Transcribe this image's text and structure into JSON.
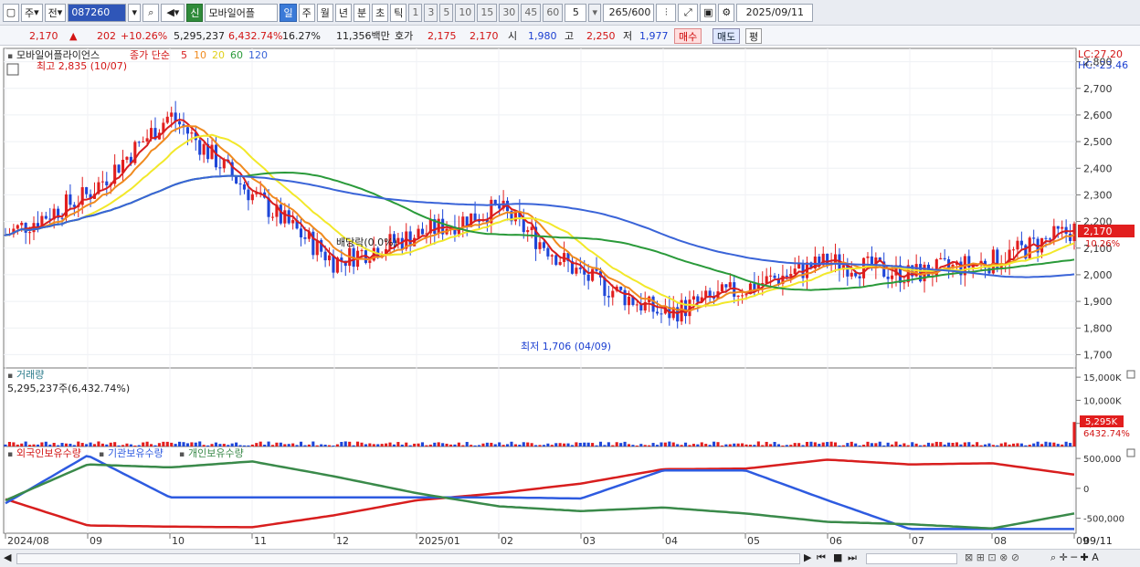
{
  "toolbar": {
    "type_label": "주",
    "prev_label": "전",
    "stock_code": "087260",
    "new_badge": "신",
    "stock_name": "모바일어플",
    "periods": [
      "일",
      "주",
      "월",
      "년",
      "분",
      "초",
      "틱"
    ],
    "active_period": "일",
    "minute_options": [
      "1",
      "3",
      "5",
      "10",
      "15",
      "30",
      "45",
      "60"
    ],
    "interval_value": "5",
    "count_value": "265",
    "count_total": "/600",
    "date_value": "2025/09/11"
  },
  "quote": {
    "price": "2,170",
    "change": "202",
    "change_pct": "+10.26%",
    "volume": "5,295,237",
    "volume_ratio": "6,432.74%",
    "turnover": "16.27%",
    "amount": "11,356백만",
    "bid_label": "호가",
    "bid_value": "2,175",
    "ask_value": "2,170",
    "open_label": "시",
    "open_value": "1,980",
    "high_label": "고",
    "high_value": "2,250",
    "low_label": "저",
    "low_value": "1,977",
    "buy_label": "매수",
    "sell_label": "매도",
    "avg_label": "평"
  },
  "price_panel": {
    "title": "모바일어플라이언스",
    "legend_prefix": "종가 단순",
    "ma_periods": [
      "5",
      "10",
      "20",
      "60",
      "120"
    ],
    "ma_colors": [
      "#d81e1e",
      "#f08a1e",
      "#f2e82a",
      "#2a9a3a",
      "#3a64d8"
    ],
    "high_annotation": "최고 2,835 (10/07)",
    "low_annotation": "최저 1,706 (04/09)",
    "dividend_annotation": "배당락(0.0%)",
    "lc_label": "LC:27.20",
    "hc_label": "HC:-23.46",
    "y_ticks": [
      "2,800",
      "2,700",
      "2,600",
      "2,500",
      "2,400",
      "2,300",
      "2,200",
      "2,100",
      "2,000",
      "1,900",
      "1,800",
      "1,700"
    ],
    "current_price_tag": "2,170",
    "current_pct_tag": "10.26%"
  },
  "volume_panel": {
    "title": "거래량",
    "current_volume": "5,295,237주(6,432.74%)",
    "y_ticks": [
      "15,000K",
      "10,000K",
      "5,000K"
    ],
    "volume_tag": "5,295K",
    "ratio_tag": "6432.74%"
  },
  "holdings_panel": {
    "series_labels": [
      "외국인보유수량",
      "기관보유수량",
      "개인보유수량"
    ],
    "series_colors": [
      "#d81e1e",
      "#2e5be0",
      "#3a8a4a"
    ],
    "y_ticks": [
      "500,000",
      "0",
      "-500,000"
    ]
  },
  "x_axis": {
    "labels": [
      "2024/08",
      "09",
      "10",
      "11",
      "12",
      "2025/01",
      "02",
      "03",
      "04",
      "05",
      "06",
      "07",
      "08",
      "09"
    ],
    "last_label": "09/11"
  },
  "chart_data": {
    "type": "line",
    "title": "모바일어플라이언스",
    "x": [
      "2024/08",
      "09",
      "10",
      "11",
      "12",
      "2025/01",
      "02",
      "03",
      "04",
      "05",
      "06",
      "07",
      "08",
      "09"
    ],
    "series": [
      {
        "name": "종가",
        "values": [
          2150,
          2300,
          2600,
          2300,
          2050,
          2150,
          2250,
          2000,
          1850,
          1950,
          2050,
          2000,
          2050,
          2170
        ]
      },
      {
        "name": "외국인보유수량",
        "values": [
          -180000,
          -620000,
          -640000,
          -650000,
          -450000,
          -200000,
          -80000,
          80000,
          320000,
          330000,
          480000,
          400000,
          420000,
          230000
        ]
      },
      {
        "name": "기관보유수량",
        "values": [
          -250000,
          550000,
          -150000,
          -150000,
          -150000,
          -150000,
          -150000,
          -170000,
          300000,
          300000,
          -200000,
          -680000,
          -680000,
          -680000
        ]
      },
      {
        "name": "개인보유수량",
        "values": [
          -200000,
          400000,
          350000,
          450000,
          200000,
          -80000,
          -300000,
          -380000,
          -320000,
          -420000,
          -560000,
          -600000,
          -670000,
          -420000
        ]
      }
    ],
    "ylim": [
      1650,
      2850
    ]
  }
}
